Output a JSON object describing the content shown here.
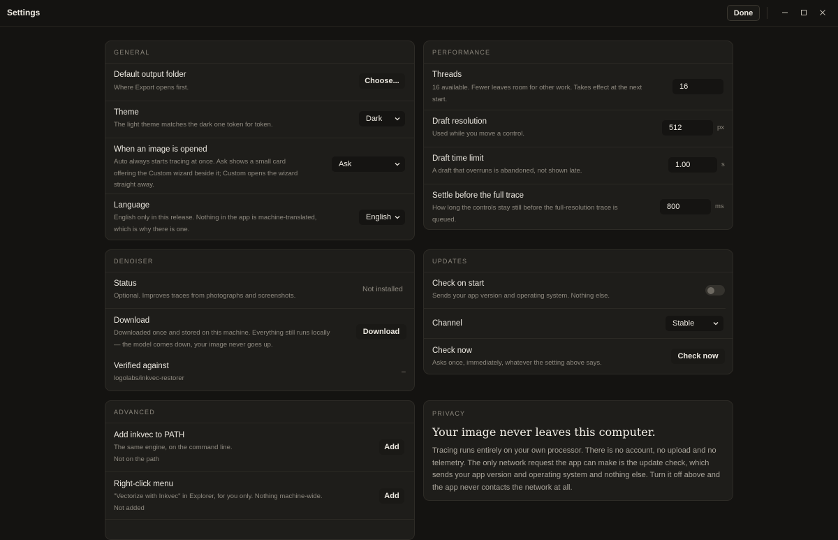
{
  "window": {
    "title": "Settings",
    "done_label": "Done",
    "minimize_icon": "minimize-icon",
    "maximize_icon": "maximize-icon",
    "close_icon": "close-icon"
  },
  "general": {
    "label": "GENERAL",
    "output_folder": {
      "title": "Default output folder",
      "desc": "Where Export opens first.",
      "button": "Choose..."
    },
    "theme": {
      "title": "Theme",
      "desc": "The light theme matches the dark one token for token.",
      "value": "Dark"
    },
    "image_opened": {
      "title": "When an image is opened",
      "desc_lines": [
        "Auto always starts tracing at once. Ask shows a small card",
        "offering the Custom wizard beside it; Custom opens the wizard",
        "straight away."
      ],
      "value": "Ask"
    },
    "language": {
      "title": "Language",
      "desc_lines": [
        "English only in this release. Nothing in the app is machine-translated,",
        "which is why there is one."
      ],
      "value": "English"
    }
  },
  "performance": {
    "label": "PERFORMANCE",
    "threads": {
      "title": "Threads",
      "desc_lines": [
        "16 available. Fewer leaves room for other work. Takes effect at the next",
        "start."
      ],
      "value": "16"
    },
    "draft_resolution": {
      "title": "Draft resolution",
      "desc": "Used while you move a control.",
      "value": "512",
      "unit": "px"
    },
    "draft_time_limit": {
      "title": "Draft time limit",
      "desc": "A draft that overruns is abandoned, not shown late.",
      "value": "1.00",
      "unit": "s"
    },
    "settle": {
      "title": "Settle before the full trace",
      "desc_lines": [
        "How long the controls stay still before the full-resolution trace is",
        "queued."
      ],
      "value": "800",
      "unit": "ms"
    }
  },
  "denoiser": {
    "label": "DENOISER",
    "status": {
      "title": "Status",
      "desc": "Optional. Improves traces from photographs and screenshots.",
      "value": "Not installed"
    },
    "download": {
      "title": "Download",
      "desc_lines": [
        "Downloaded once and stored on this machine. Everything still runs locally",
        "— the model comes down, your image never goes up."
      ],
      "button": "Download"
    },
    "verified": {
      "title": "Verified against",
      "desc": "logolabs/inkvec-restorer",
      "value": "–"
    }
  },
  "updates": {
    "label": "UPDATES",
    "check_on_start": {
      "title": "Check on start",
      "desc": "Sends your app version and operating system. Nothing else.",
      "enabled": false
    },
    "channel": {
      "title": "Channel",
      "value": "Stable"
    },
    "check_now": {
      "title": "Check now",
      "desc": "Asks once, immediately, whatever the setting above says.",
      "button": "Check now"
    }
  },
  "advanced": {
    "label": "ADVANCED",
    "path": {
      "title": "Add inkvec to PATH",
      "desc": "The same engine, on the command line.",
      "status": "Not on the path",
      "button": "Add"
    },
    "right_click": {
      "title": "Right-click menu",
      "desc": "\"Vectorize with Inkvec\" in Explorer, for you only. Nothing machine-wide.",
      "status": "Not added",
      "button": "Add"
    }
  },
  "privacy": {
    "label": "PRIVACY",
    "heading": "Your image never leaves this computer.",
    "body": "Tracing runs entirely on your own processor. There is no account, no upload and no telemetry. The only network request the app can make is the update check, which sends your app version and operating system and nothing else. Turn it off above and the app never contacts the network at all."
  }
}
